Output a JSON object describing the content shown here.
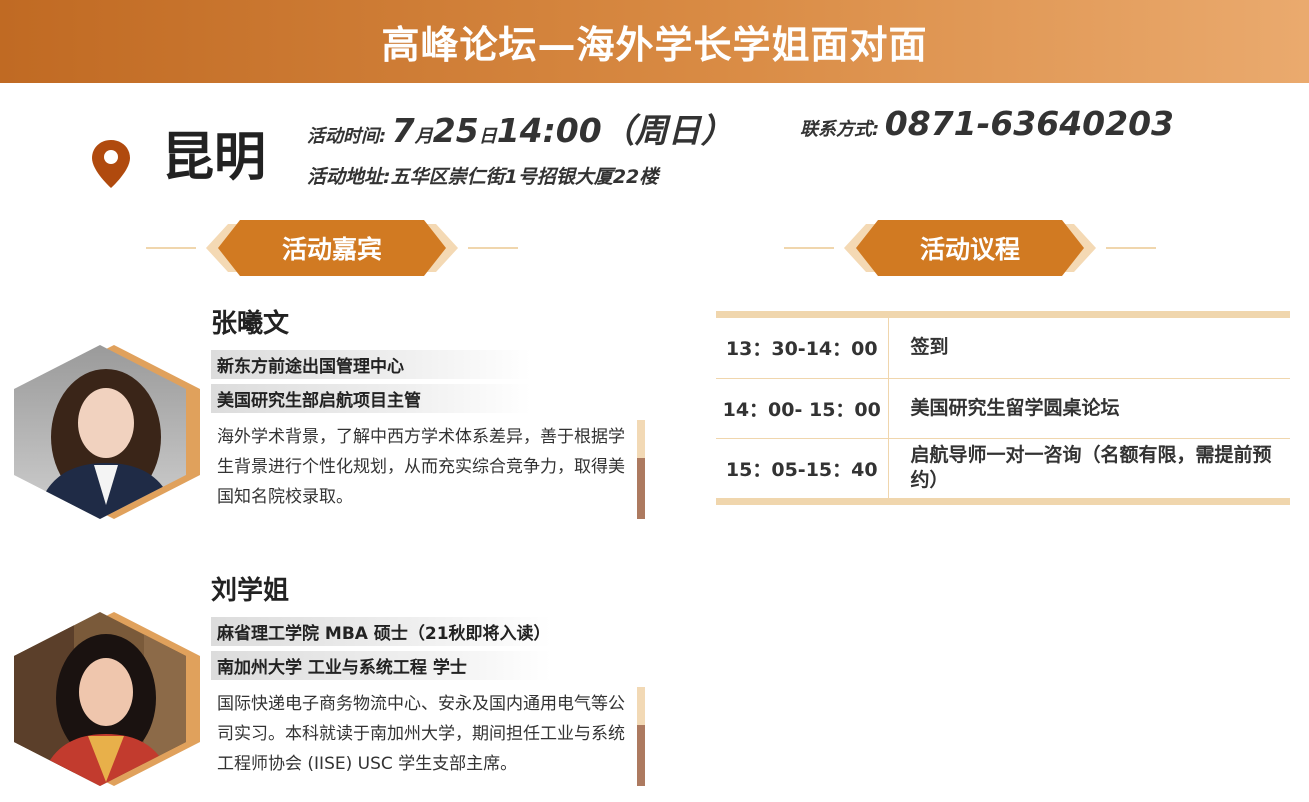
{
  "banner": {
    "title": "高峰论坛—海外学长学姐面对面"
  },
  "location": {
    "city": "昆明",
    "icon": "location-pin-icon"
  },
  "event": {
    "time_label": "活动时间:",
    "time_month": "7",
    "time_month_unit": "月",
    "time_day": "25",
    "time_day_unit": "日",
    "time_clock": "14:00（周日）",
    "contact_label": "联系方式:",
    "contact_value": "0871-63640203",
    "address_label": "活动地址:",
    "address_value": "五华区崇仁街1号招银大厦22楼"
  },
  "sections": {
    "guests_title": "活动嘉宾",
    "agenda_title": "活动议程"
  },
  "guests": [
    {
      "name": "张曦文",
      "tag1": "新东方前途出国管理中心",
      "tag2": "美国研究生部启航项目主管",
      "bio": "海外学术背景，了解中西方学术体系差异，善于根据学生背景进行个性化规划，从而充实综合竞争力，取得美国知名院校录取。"
    },
    {
      "name": "刘学姐",
      "tag1": "麻省理工学院 MBA 硕士（21秋即将入读）",
      "tag2": "南加州大学 工业与系统工程 学士",
      "bio": "国际快递电子商务物流中心、安永及国内通用电气等公司实习。本科就读于南加州大学，期间担任工业与系统工程师协会 (IISE) USC 学生支部主席。"
    }
  ],
  "agenda": [
    {
      "time": "13：30-14：00",
      "desc": "签到"
    },
    {
      "time": "14：00- 15：00",
      "desc": "美国研究生留学圆桌论坛"
    },
    {
      "time": "15：05-15：40",
      "desc": "启航导师一对一咨询（名额有限，需提前预约）"
    }
  ],
  "colors": {
    "accent": "#d17a22",
    "accent_light": "#f0d6ad",
    "banner_start": "#c06a23",
    "banner_end": "#eaaa6e",
    "pin": "#b04a0e"
  }
}
